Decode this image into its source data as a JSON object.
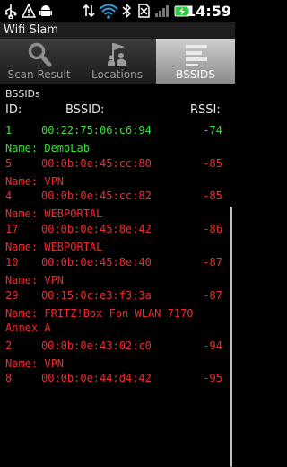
{
  "status_bar": {
    "time": "14:59"
  },
  "app": {
    "title": "Wifi Slam"
  },
  "tabs": [
    {
      "label": "Scan Result",
      "icon": "magnifier-icon",
      "selected": false
    },
    {
      "label": "Locations",
      "icon": "location-marker-icon",
      "selected": false
    },
    {
      "label": "BSSIDS",
      "icon": "list-icon",
      "selected": true
    }
  ],
  "list": {
    "section_title": "BSSIDs",
    "headers": {
      "id": "ID:",
      "bssid": "BSSID:",
      "rssi": "RSSI:"
    },
    "rows": [
      {
        "id": "1",
        "bssid": "00:22:75:06:c6:94",
        "rssi": "-74",
        "name": "Name: DemoLab",
        "color": "#3ddc3d"
      },
      {
        "id": "5",
        "bssid": "00:0b:0e:45:cc:80",
        "rssi": "-85",
        "name": "Name: VPN",
        "color": "#ee2b2b"
      },
      {
        "id": "4",
        "bssid": "00:0b:0e:45:cc:82",
        "rssi": "-85",
        "name": "Name: WEBPORTAL",
        "color": "#ee2b2b"
      },
      {
        "id": "17",
        "bssid": "00:0b:0e:45:8e:42",
        "rssi": "-86",
        "name": "Name: WEBPORTAL",
        "color": "#ee2b2b"
      },
      {
        "id": "10",
        "bssid": "00:0b:0e:45:8e:40",
        "rssi": "-87",
        "name": "Name: VPN",
        "color": "#ee2b2b"
      },
      {
        "id": "29",
        "bssid": "00:15:0c:e3:f3:3a",
        "rssi": "-87",
        "name": "Name: FRITZ!Box Fon WLAN 7170 Annex A",
        "color": "#ee2b2b"
      },
      {
        "id": "2",
        "bssid": "00:0b:0e:43:02:c0",
        "rssi": "-94",
        "name": "Name: VPN",
        "color": "#ee2b2b"
      },
      {
        "id": "8",
        "bssid": "00:0b:0e:44:d4:42",
        "rssi": "-95",
        "name": "",
        "color": "#ee2b2b"
      }
    ]
  }
}
